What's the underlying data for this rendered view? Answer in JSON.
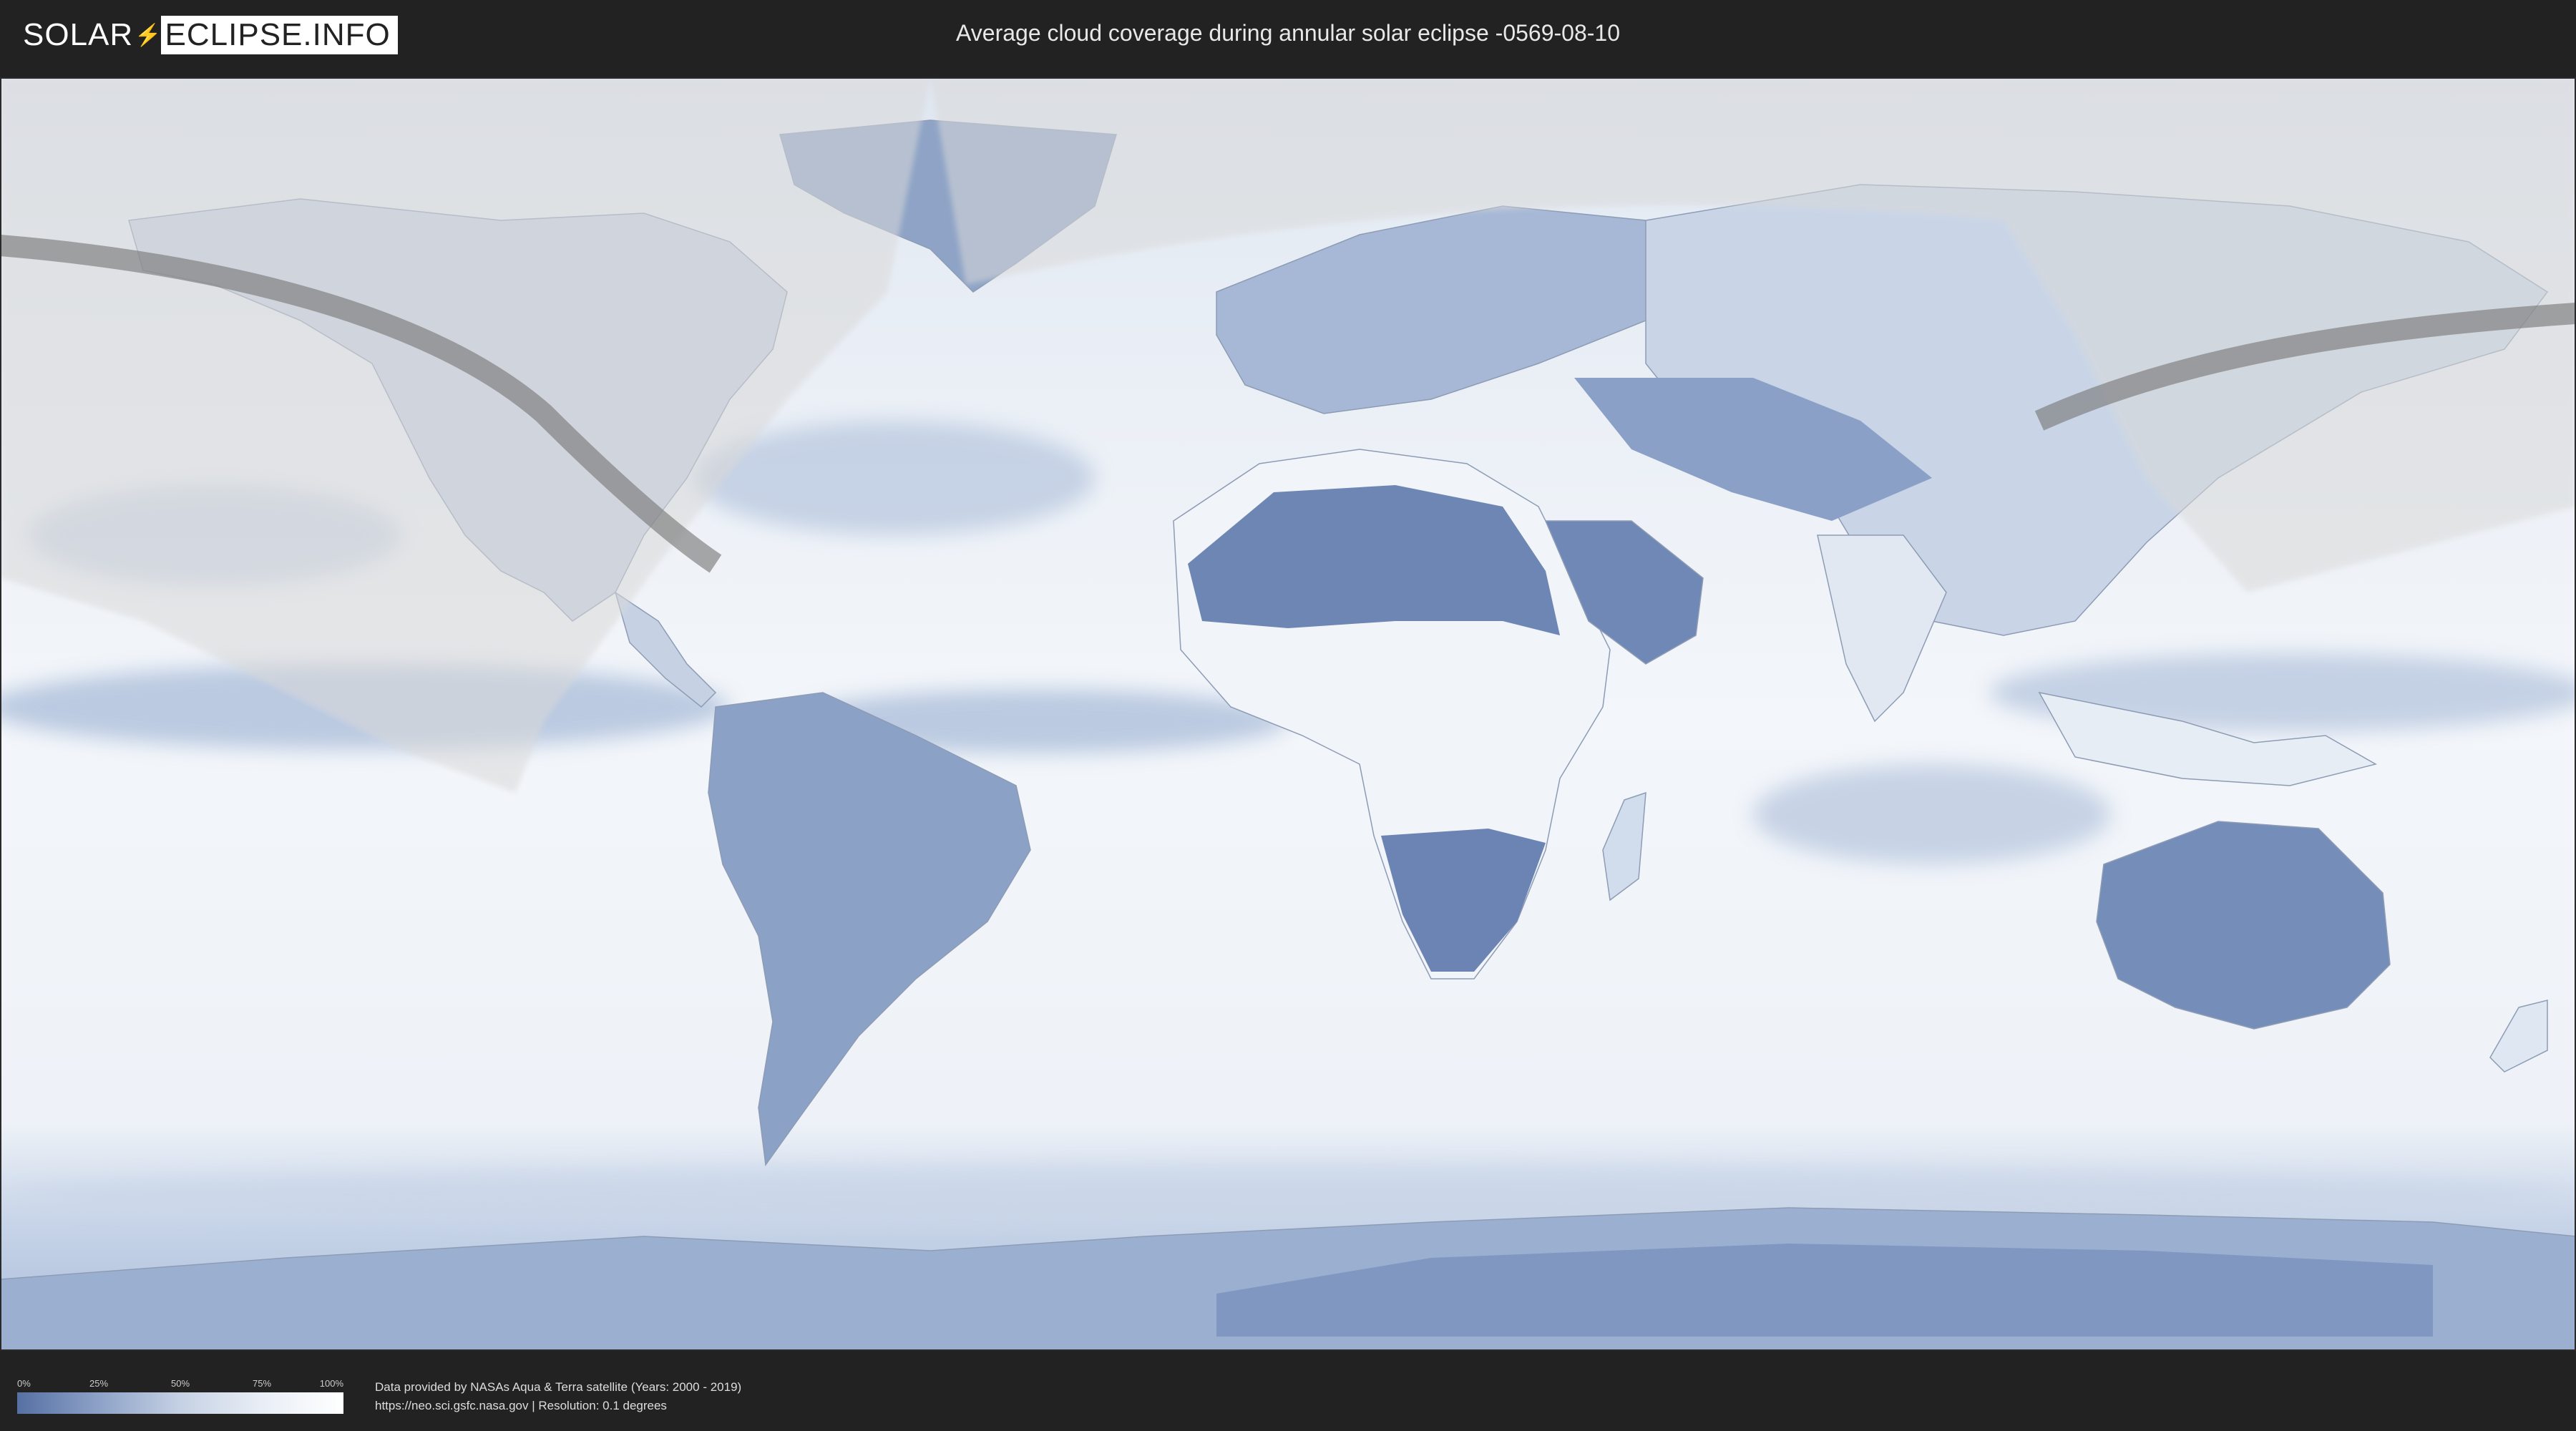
{
  "header": {
    "logo_left": "SOLAR",
    "logo_right": "ECLIPSE.INFO",
    "title": "Average cloud coverage during annular solar eclipse -0569-08-10"
  },
  "map": {
    "type": "cloud-coverage-world-map",
    "eclipse_date": "-0569-08-10",
    "colors": {
      "ocean_cloud": "#eef2f8",
      "clear_land": "#5d78ab",
      "mid": "#a9bbd8",
      "night_shade": "#d8d8d8",
      "eclipse_path": "#7c7c7c"
    }
  },
  "legend": {
    "ticks": [
      "0%",
      "25%",
      "50%",
      "75%",
      "100%"
    ],
    "colors": [
      "#5670a3",
      "#8da2c7",
      "#c5d1e4",
      "#e9eef6",
      "#ffffff"
    ]
  },
  "footer": {
    "credit_line1": "Data provided by NASAs Aqua & Terra satellite (Years: 2000 - 2019)",
    "credit_line2": "https://neo.sci.gsfc.nasa.gov | Resolution: 0.1 degrees"
  }
}
